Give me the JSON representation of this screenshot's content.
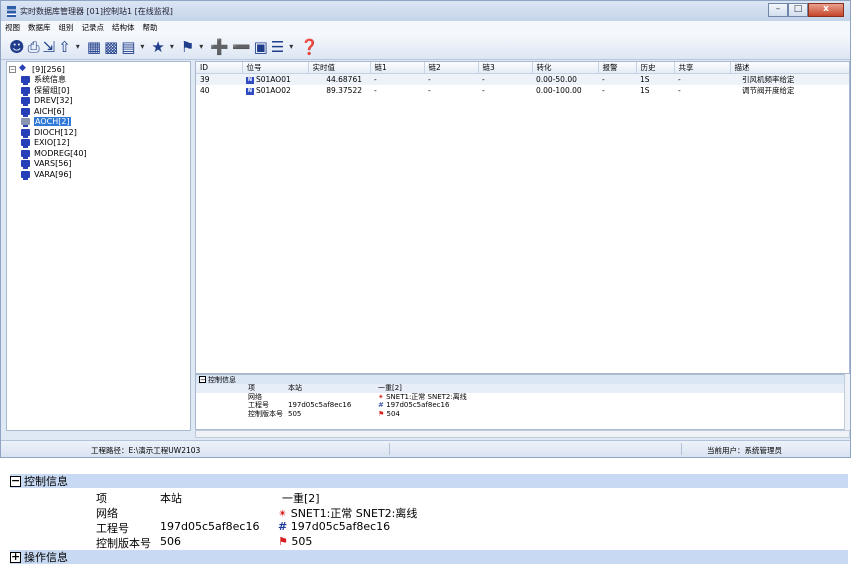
{
  "window": {
    "title": "实时数据库管理器 [01]控制站1 [在线监视]",
    "buttons": {
      "minimize": "–",
      "maximize": "□",
      "close": "x"
    }
  },
  "menu": [
    "视图",
    "数据库",
    "组别",
    "记录点",
    "结构体",
    "帮助"
  ],
  "toolbar_icons": [
    "user-icon",
    "printer-icon",
    "import-icon",
    "export-icon",
    "grid-icon",
    "structure-icon",
    "list-icon",
    "star-icon",
    "flag-icon",
    "tag-add-icon",
    "tag-remove-icon",
    "monitor-icon",
    "document-icon",
    "help-icon"
  ],
  "tree": {
    "root": "[9][256]",
    "items": [
      "系统信息",
      "保留组[0]",
      "DREV[32]",
      "AICH[6]",
      "AOCH[2]",
      "DIOCH[12]",
      "EXIO[12]",
      "MODREG[40]",
      "VARS[56]",
      "VARA[96]"
    ],
    "selected": "AOCH[2]"
  },
  "grid": {
    "columns": [
      "ID",
      "位号",
      "实时值",
      "链1",
      "链2",
      "链3",
      "转化",
      "报警",
      "历史",
      "共享",
      "描述"
    ],
    "rows": [
      {
        "id": "39",
        "tag": "S01AO01",
        "value": "44.68761",
        "l1": "-",
        "l2": "-",
        "l3": "-",
        "conv": "0.00-50.00",
        "alarm": "-",
        "hist": "1S",
        "share": "-",
        "desc": "引风机频率给定"
      },
      {
        "id": "40",
        "tag": "S01AO02",
        "value": "89.37522",
        "l1": "-",
        "l2": "-",
        "l3": "-",
        "conv": "0.00-100.00",
        "alarm": "-",
        "hist": "1S",
        "share": "-",
        "desc": "调节阀开度给定"
      }
    ]
  },
  "control_panel": {
    "header": "控制信息",
    "col_item": "项",
    "col_local": "本站",
    "col_redundant": "一重[2]",
    "rows": [
      {
        "item": "网络",
        "local": "",
        "redundant": "SNET1:正常  SNET2:离线"
      },
      {
        "item": "工程号",
        "local": "197d05c5af8ec16",
        "redundant": "197d05c5af8ec16"
      },
      {
        "item": "控制版本号",
        "local": "505",
        "redundant": "504"
      }
    ]
  },
  "status": {
    "path": "工程路径：E:\\演示工程UW2103",
    "user": "当前用户：系统管理员"
  },
  "zoom_panel": {
    "control_header": "控制信息",
    "col_item": "项",
    "col_local": "本站",
    "col_redundant": "一重[2]",
    "rows": [
      {
        "item": "网络",
        "local": "",
        "redundant": "SNET1:正常  SNET2:离线"
      },
      {
        "item": "工程号",
        "local": "197d05c5af8ec16",
        "redundant": "197d05c5af8ec16"
      },
      {
        "item": "控制版本号",
        "local": "506",
        "redundant": "505"
      }
    ],
    "ops_header": "操作信息",
    "expand_minus": "−",
    "expand_plus": "+"
  }
}
